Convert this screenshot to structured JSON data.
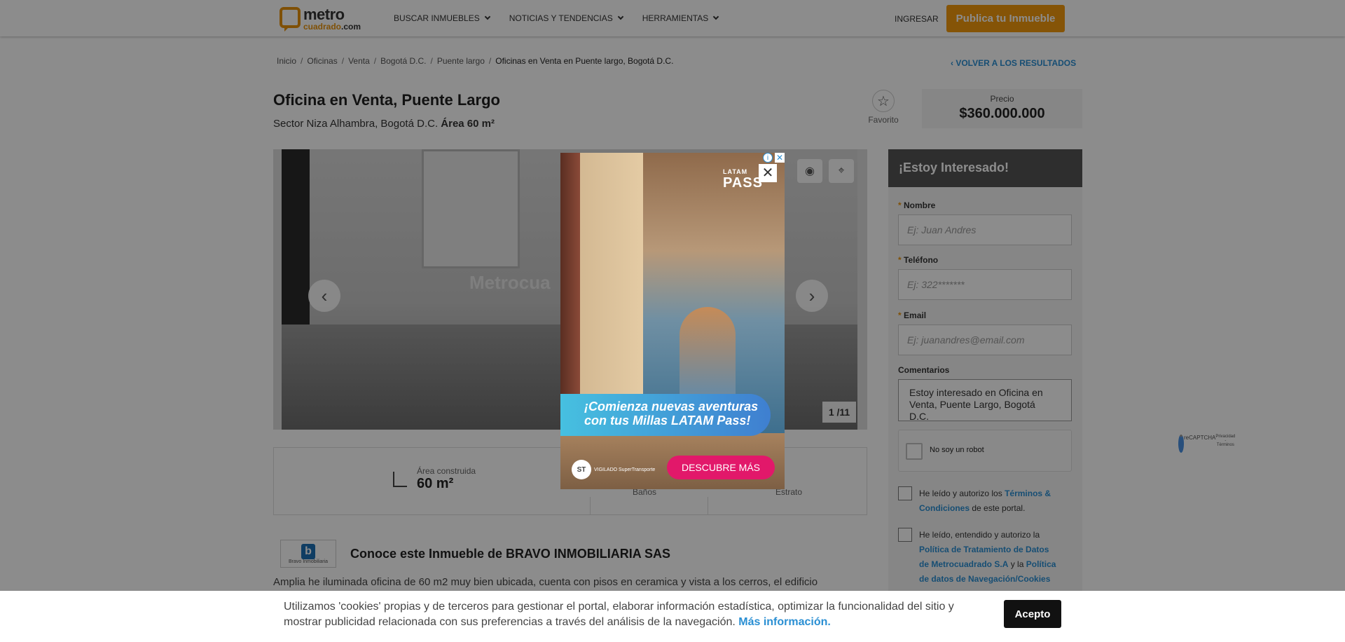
{
  "header": {
    "logo_main": "metro",
    "logo_sub": "cuadrado",
    "logo_tld": ".com",
    "nav": [
      "BUSCAR INMUEBLES",
      "NOTICIAS Y TENDENCIAS",
      "HERRAMIENTAS"
    ],
    "login": "INGRESAR",
    "publish": "Publica tu Inmueble"
  },
  "breadcrumb": [
    "Inicio",
    "Oficinas",
    "Venta",
    "Bogotá D.C.",
    "Puente largo",
    "Oficinas en Venta en Puente largo, Bogotá D.C."
  ],
  "back_link": "VOLVER A LOS RESULTADOS",
  "listing": {
    "title": "Oficina en Venta, Puente Largo",
    "location": "Sector Niza Alhambra, Bogotá D.C.",
    "area_label": "Área 60 m²",
    "favorite": "Favorito",
    "price_label": "Precio",
    "price": "$360.000.000"
  },
  "gallery": {
    "watermark": "Metrocua",
    "counter": "1 /11",
    "icons": [
      "camera-icon",
      "map-pin-icon",
      "chevron-left-icon",
      "chevron-right-icon"
    ]
  },
  "features": {
    "area_label": "Área construida",
    "area_value": "60 m²",
    "banos": "Baños",
    "estrato": "Estrato"
  },
  "agent": {
    "logo_text": "Bravo Inmobiliaria",
    "title": "Conoce este Inmueble de BRAVO INMOBILIARIA SAS",
    "description": "Amplia he iluminada oficina de 60 m2 muy bien ubicada, cuenta con pisos en ceramica y vista a los cerros, el edificio"
  },
  "form": {
    "heading": "¡Estoy Interesado!",
    "name_label": "Nombre",
    "name_placeholder": "Ej: Juan Andres",
    "phone_label": "Teléfono",
    "phone_placeholder": "Ej: 322*******",
    "email_label": "Email",
    "email_placeholder": "Ej: juanandres@email.com",
    "comments_label": "Comentarios",
    "comments_value": "Estoy interesado en Oficina en Venta, Puente Largo, Bogotá D.C.",
    "captcha_text": "No soy un robot",
    "captcha_brand": "reCAPTCHA",
    "captcha_links": "Privacidad - Términos",
    "terms_pre": "He leído y autorizo los",
    "terms_link": "Términos & Condiciones",
    "terms_post": "de este portal.",
    "policy_pre": "He leído, entendido y autorizo la",
    "policy_link": "Política de Tratamiento de Datos de Metrocuadrado S.A",
    "policy_mid": "y la",
    "policy_link2": "Política de datos de Navegación/Cookies"
  },
  "ad": {
    "brand_small": "LATAM",
    "brand": "PASS",
    "headline": "¡Comienza nuevas aventuras con tus Millas LATAM Pass!",
    "vigilado": "VIGILADO SuperTransporte",
    "cta": "DESCUBRE MÁS",
    "info": "i",
    "close": "✕"
  },
  "cookie": {
    "text": "Utilizamos 'cookies' propias y de terceros para gestionar el portal, elaborar información estadística, optimizar la funcionalidad del sitio y mostrar publicidad relacionada con sus preferencias a través del análisis de la navegación.",
    "more": "Más información.",
    "accept": "Acepto"
  }
}
